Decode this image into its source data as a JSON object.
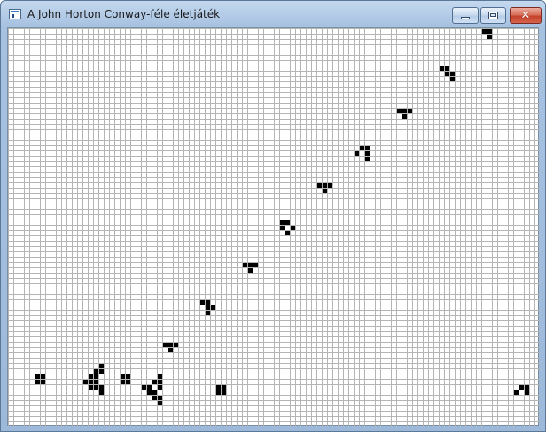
{
  "window": {
    "title": "A John Horton Conway-féle életjáték",
    "icon": "app-window-icon",
    "controls": {
      "minimize_icon": "minimize-icon",
      "maximize_icon": "maximize-icon",
      "close_icon": "close-icon",
      "close_glyph": "✕"
    }
  },
  "board": {
    "columns": 100,
    "rows": 75,
    "cell_color": "#000000",
    "grid_color": "#b4b4b4",
    "live_cells": [
      [
        89,
        0
      ],
      [
        90,
        0
      ],
      [
        90,
        1
      ],
      [
        81,
        7
      ],
      [
        82,
        7
      ],
      [
        82,
        8
      ],
      [
        83,
        8
      ],
      [
        83,
        9
      ],
      [
        73,
        15
      ],
      [
        74,
        15
      ],
      [
        75,
        15
      ],
      [
        74,
        16
      ],
      [
        66,
        22
      ],
      [
        67,
        22
      ],
      [
        65,
        23
      ],
      [
        67,
        23
      ],
      [
        67,
        24
      ],
      [
        58,
        29
      ],
      [
        59,
        29
      ],
      [
        60,
        29
      ],
      [
        59,
        30
      ],
      [
        51,
        36
      ],
      [
        52,
        36
      ],
      [
        51,
        37
      ],
      [
        53,
        37
      ],
      [
        52,
        38
      ],
      [
        44,
        44
      ],
      [
        45,
        44
      ],
      [
        46,
        44
      ],
      [
        45,
        45
      ],
      [
        36,
        51
      ],
      [
        37,
        51
      ],
      [
        37,
        52
      ],
      [
        38,
        52
      ],
      [
        37,
        53
      ],
      [
        29,
        59
      ],
      [
        30,
        59
      ],
      [
        31,
        59
      ],
      [
        30,
        60
      ],
      [
        17,
        63
      ],
      [
        16,
        64
      ],
      [
        17,
        64
      ],
      [
        15,
        65
      ],
      [
        16,
        65
      ],
      [
        14,
        66
      ],
      [
        15,
        66
      ],
      [
        16,
        66
      ],
      [
        15,
        67
      ],
      [
        16,
        67
      ],
      [
        17,
        67
      ],
      [
        17,
        68
      ],
      [
        5,
        65
      ],
      [
        6,
        65
      ],
      [
        5,
        66
      ],
      [
        6,
        66
      ],
      [
        21,
        65
      ],
      [
        22,
        65
      ],
      [
        21,
        66
      ],
      [
        22,
        66
      ],
      [
        28,
        65
      ],
      [
        27,
        66
      ],
      [
        28,
        66
      ],
      [
        25,
        67
      ],
      [
        26,
        67
      ],
      [
        28,
        67
      ],
      [
        26,
        68
      ],
      [
        27,
        68
      ],
      [
        27,
        69
      ],
      [
        28,
        69
      ],
      [
        28,
        70
      ],
      [
        39,
        67
      ],
      [
        40,
        67
      ],
      [
        39,
        68
      ],
      [
        40,
        68
      ],
      [
        96,
        67
      ],
      [
        97,
        67
      ],
      [
        95,
        68
      ],
      [
        97,
        68
      ]
    ]
  }
}
